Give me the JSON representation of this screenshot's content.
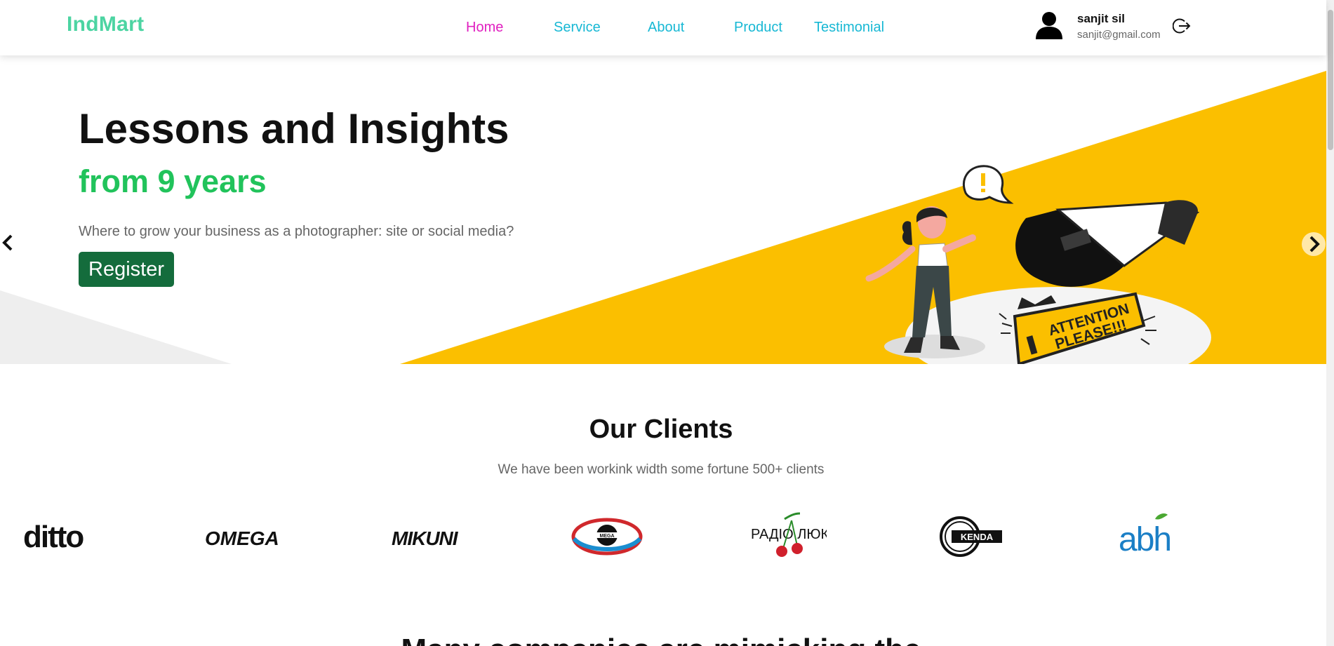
{
  "header": {
    "logo": "IndMart",
    "nav": [
      {
        "label": "Home",
        "active": true
      },
      {
        "label": "Service",
        "active": false
      },
      {
        "label": "About",
        "active": false
      },
      {
        "label": "Product",
        "active": false
      },
      {
        "label": "Testimonial",
        "active": false
      }
    ],
    "user": {
      "name": "sanjit sil",
      "email": "sanjit@gmail.com",
      "avatar_icon": "user-icon",
      "logout_icon": "logout-icon"
    }
  },
  "hero": {
    "title": "Lessons and Insights",
    "subtitle": "from 9 years",
    "description": "Where to grow your business as a photographer: site or social media?",
    "cta": "Register",
    "illustration_text": "ATTENTION PLEASE!!!",
    "prev_icon": "chevron-left-icon",
    "next_icon": "chevron-right-icon",
    "accent_color": "#fbbf00"
  },
  "clients": {
    "title": "Our Clients",
    "description": "We have been workink width some fortune 500+ clients",
    "logos": [
      "ditto",
      "OMEGA",
      "MIKUNI",
      "MEGA",
      "РАДІО ЛЮКС",
      "KENDA",
      "abh"
    ]
  },
  "next_section": {
    "title": "Many companies are mimicking the"
  },
  "colors": {
    "logo": "#4cd4a2",
    "nav": "#17b8d4",
    "nav_active": "#e020c0",
    "subtitle": "#21c35b",
    "button": "#146c3c"
  }
}
